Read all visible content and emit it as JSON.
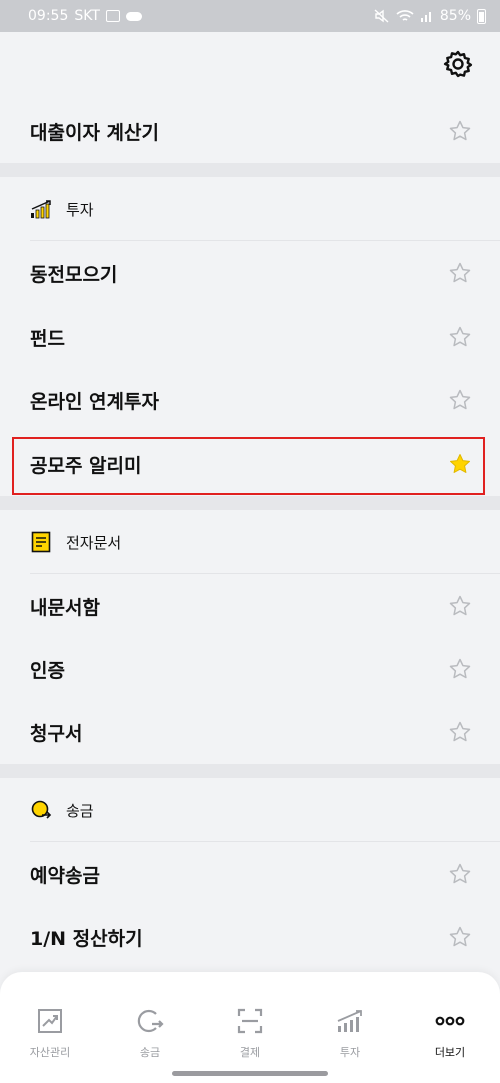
{
  "status_bar": {
    "time": "09:55",
    "carrier": "SKT",
    "battery": "85%"
  },
  "header": {
    "settings_icon": "gear-icon"
  },
  "top_item": {
    "label": "대출이자 계산기",
    "starred": false
  },
  "sections": [
    {
      "title": "투자",
      "icon": "chart-bars-icon",
      "items": [
        {
          "label": "동전모으기",
          "starred": false
        },
        {
          "label": "펀드",
          "starred": false
        },
        {
          "label": "온라인 연계투자",
          "starred": false
        },
        {
          "label": "공모주 알리미",
          "starred": true
        }
      ]
    },
    {
      "title": "전자문서",
      "icon": "document-icon",
      "items": [
        {
          "label": "내문서함",
          "starred": false
        },
        {
          "label": "인증",
          "starred": false
        },
        {
          "label": "청구서",
          "starred": false
        }
      ]
    },
    {
      "title": "송금",
      "icon": "transfer-icon",
      "items": [
        {
          "label": "예약송금",
          "starred": false
        },
        {
          "label": "1/N 정산하기",
          "starred": false
        }
      ]
    }
  ],
  "tabbar": {
    "tabs": [
      {
        "label": "자산관리",
        "icon": "asset-chart-icon",
        "active": false
      },
      {
        "label": "송금",
        "icon": "send-money-icon",
        "active": false
      },
      {
        "label": "결제",
        "icon": "scan-frame-icon",
        "active": false
      },
      {
        "label": "투자",
        "icon": "invest-bars-icon",
        "active": false
      },
      {
        "label": "더보기",
        "icon": "more-dots-icon",
        "active": true
      }
    ]
  },
  "colors": {
    "accent_star": "#ffd400",
    "highlight_border": "#e0201f",
    "background": "#f2f3f5"
  }
}
